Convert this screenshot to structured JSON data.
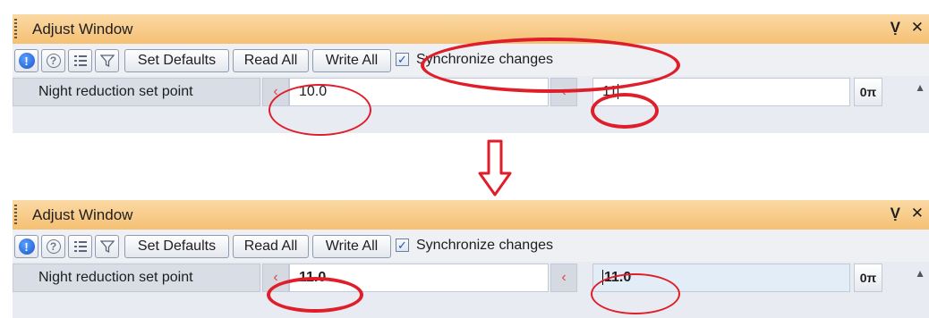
{
  "panels": [
    {
      "title": "Adjust Window",
      "pin_glyph": "ԉ",
      "close_glyph": "✕",
      "toolbar": {
        "info_icon": "info-icon",
        "help_icon": "help-icon",
        "list_icon": "list-icon",
        "filter_icon": "filter-icon",
        "set_defaults_label": "Set Defaults",
        "read_all_label": "Read All",
        "write_all_label": "Write All",
        "synchronize_label": "Synchronize changes",
        "synchronize_checked": true
      },
      "row": {
        "label": "Night reduction set point",
        "left_arrow": "‹",
        "left_value": "10.0",
        "right_arrow": "‹",
        "right_value": "11",
        "key_glyph": "0π"
      }
    },
    {
      "title": "Adjust Window",
      "pin_glyph": "ԉ",
      "close_glyph": "✕",
      "toolbar": {
        "info_icon": "info-icon",
        "help_icon": "help-icon",
        "list_icon": "list-icon",
        "filter_icon": "filter-icon",
        "set_defaults_label": "Set Defaults",
        "read_all_label": "Read All",
        "write_all_label": "Write All",
        "synchronize_label": "Synchronize changes",
        "synchronize_checked": true
      },
      "row": {
        "label": "Night reduction set point",
        "left_arrow": "‹",
        "left_value": "11.0",
        "right_arrow": "‹",
        "right_value": "11.0",
        "key_glyph": "0π"
      }
    }
  ],
  "colors": {
    "titlebar": "#f5c073",
    "annotation": "#e01e2a",
    "checkmark": "#2a4fb0"
  }
}
